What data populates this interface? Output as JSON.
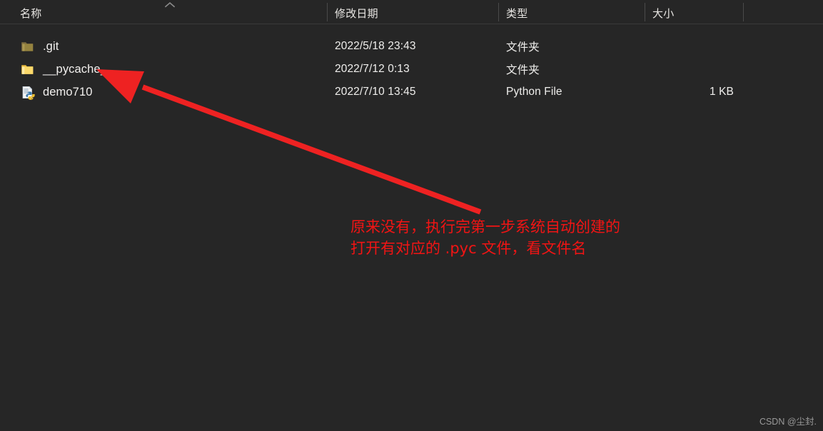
{
  "columns": {
    "name": "名称",
    "date_modified": "修改日期",
    "type": "类型",
    "size": "大小",
    "sort_indicator": "chevron-up-icon"
  },
  "files": [
    {
      "name": ".git",
      "icon": "folder-icon-dim",
      "date_modified": "2022/5/18 23:43",
      "type": "文件夹",
      "size": ""
    },
    {
      "name": "__pycache__",
      "icon": "folder-icon",
      "date_modified": "2022/7/12 0:13",
      "type": "文件夹",
      "size": ""
    },
    {
      "name": "demo710",
      "icon": "python-file-icon",
      "date_modified": "2022/7/10 13:45",
      "type": "Python File",
      "size": "1 KB"
    }
  ],
  "annotation": {
    "line1": "原来没有，执行完第一步系统自动创建的",
    "line2": "打开有对应的 .pyc 文件，看文件名",
    "color": "#f21414",
    "arrow_color": "#ee2222"
  },
  "watermark": {
    "text": "CSDN @尘封."
  },
  "theme": {
    "background": "#262626",
    "text": "#f2f0ee",
    "divider": "#4a4a4a",
    "folder_yellow": "#f7d975",
    "folder_dim": "#8b7a4a"
  }
}
